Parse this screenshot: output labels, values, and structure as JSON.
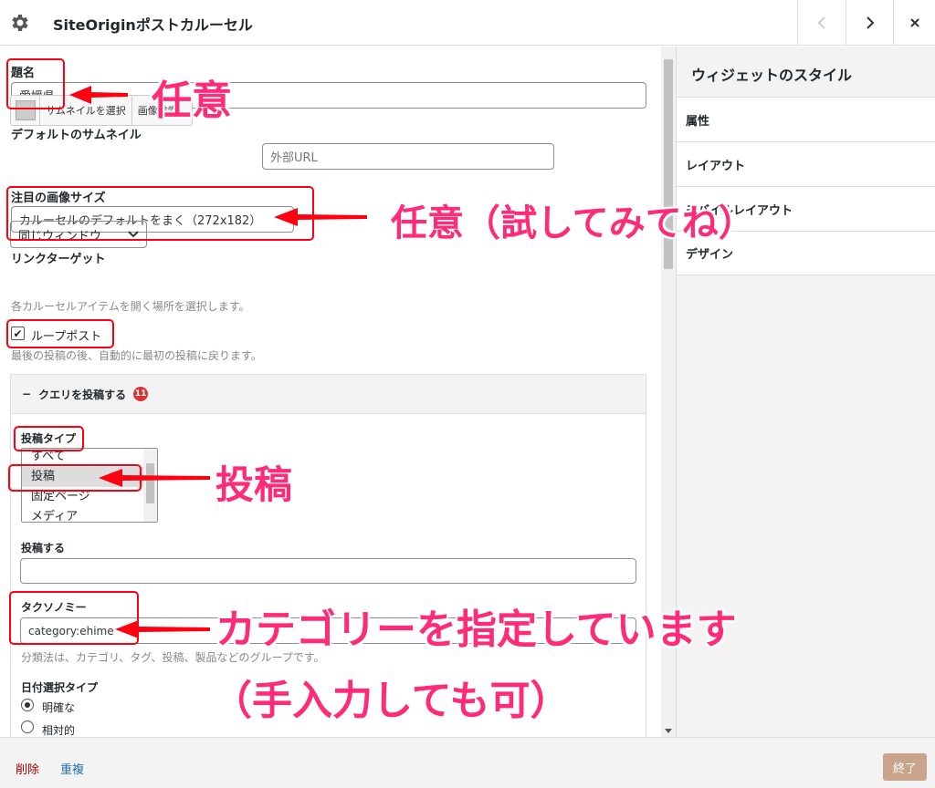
{
  "titlebar": {
    "title": "SiteOriginポストカルーセル"
  },
  "form": {
    "title_label": "題名",
    "title_value": "愛媛県",
    "thumb_label": "デフォルトのサムネイル",
    "thumb_select": "サムネイルを選択",
    "thumb_search": "画像検索",
    "external_url_placeholder": "外部URL",
    "image_size_label": "注目の画像サイズ",
    "image_size_value": "カルーセルのデフォルトをまく（272x182）",
    "link_target_label": "リンクターゲット",
    "link_target_value": "同じウィンドウ",
    "link_target_desc": "各カルーセルアイテムを開く場所を選択します。",
    "loop_label": "ループポスト",
    "loop_checked": "✔",
    "loop_desc": "最後の投稿の後、自動的に最初の投稿に戻ります。",
    "query_section": "クエリを投稿する",
    "query_badge": "11",
    "post_type_label": "投稿タイプ",
    "post_type_options": [
      "すべて",
      "投稿",
      "固定ページ",
      "メディア"
    ],
    "post_label": "投稿する",
    "taxonomy_label": "タクソノミー",
    "taxonomy_value": "category:ehime",
    "taxonomy_desc": "分類法は、カテゴリ、タグ、投稿、製品などのグループです。",
    "date_type_label": "日付選択タイプ",
    "date_options": [
      "明確な",
      "相対的"
    ]
  },
  "right_panel": {
    "title": "ウィジェットのスタイル",
    "items": [
      "属性",
      "レイアウト",
      "モバイルレイアウト",
      "デザイン"
    ]
  },
  "footer": {
    "delete": "削除",
    "duplicate": "重複",
    "done": "終了"
  },
  "annotations": {
    "a1": "任意",
    "a2": "任意（試してみてね）",
    "a3": "投稿",
    "a4": "カテゴリーを指定しています",
    "a5": "（手入力しても可）"
  },
  "colors": {
    "annotation_text": "#ff2a78",
    "annotation_box": "#ff0011",
    "done_button": "#c9a38a"
  }
}
